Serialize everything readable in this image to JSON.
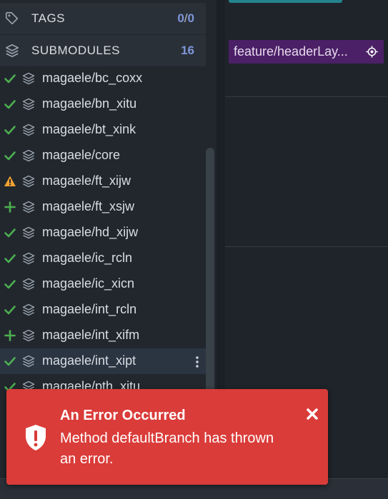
{
  "sidebar": {
    "tags": {
      "label": "TAGS",
      "count_a": "0",
      "count_sep": "/",
      "count_b": "0"
    },
    "submodules": {
      "label": "SUBMODULES",
      "count": "16"
    },
    "items": [
      {
        "label": "magaele/bc_coxx",
        "status": "check"
      },
      {
        "label": "magaele/bn_xitu",
        "status": "check"
      },
      {
        "label": "magaele/bt_xink",
        "status": "check"
      },
      {
        "label": "magaele/core",
        "status": "check"
      },
      {
        "label": "magaele/ft_xijw",
        "status": "warning"
      },
      {
        "label": "magaele/ft_xsjw",
        "status": "plus"
      },
      {
        "label": "magaele/hd_xijw",
        "status": "check"
      },
      {
        "label": "magaele/ic_rcln",
        "status": "check"
      },
      {
        "label": "magaele/ic_xicn",
        "status": "check"
      },
      {
        "label": "magaele/int_rcln",
        "status": "check"
      },
      {
        "label": "magaele/int_xifm",
        "status": "plus"
      },
      {
        "label": "magaele/int_xipt",
        "status": "check",
        "selected": true
      },
      {
        "label": "magaele/pth_xitu",
        "status": "check"
      }
    ]
  },
  "graph": {
    "branch_label": "feature/headerLay..."
  },
  "toast": {
    "title": "An Error Occurred",
    "message": "Method defaultBranch has thrown an error."
  },
  "colors": {
    "check": "#4caf50",
    "warning": "#f0a030",
    "plus": "#4caf50",
    "toast_bg": "#da3c39",
    "branch_bg": "#4b2066",
    "accent_count": "#7e96d8"
  },
  "icons": {
    "tags": "tag-icon",
    "submodules": "layers-icon",
    "item": "layers-icon",
    "branch_target": "target-icon",
    "toast_icon": "shield-alert-icon",
    "toast_close": "close-icon",
    "row_menu": "kebab-menu-icon"
  }
}
